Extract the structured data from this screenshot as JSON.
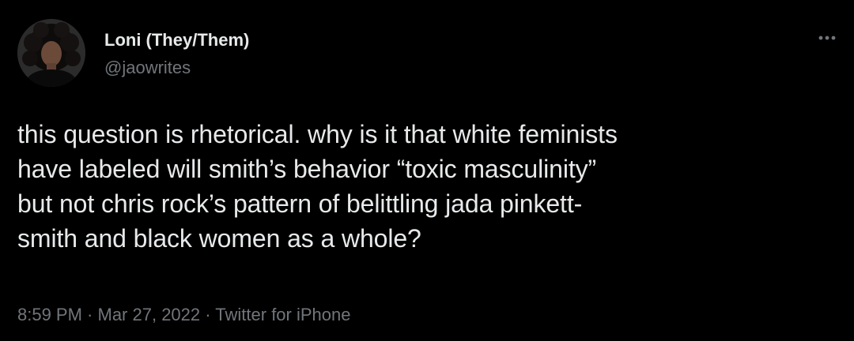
{
  "colors": {
    "background": "#000000",
    "text_primary": "#e7e9ea",
    "text_secondary": "#71767b"
  },
  "author": {
    "display_name": "Loni (They/Them)",
    "handle": "@jaowrites",
    "avatar_icon": "user-avatar"
  },
  "menu": {
    "icon": "more-horizontal-icon"
  },
  "tweet": {
    "lines": [
      "this question is rhetorical. why is it that white feminists",
      "have labeled will smith’s behavior “toxic masculinity”",
      "but not chris rock’s pattern of belittling jada pinkett-",
      "smith and black women as a whole?"
    ]
  },
  "meta": {
    "time": "8:59 PM",
    "separator": " · ",
    "date": "Mar 27, 2022",
    "source": "Twitter for iPhone"
  }
}
